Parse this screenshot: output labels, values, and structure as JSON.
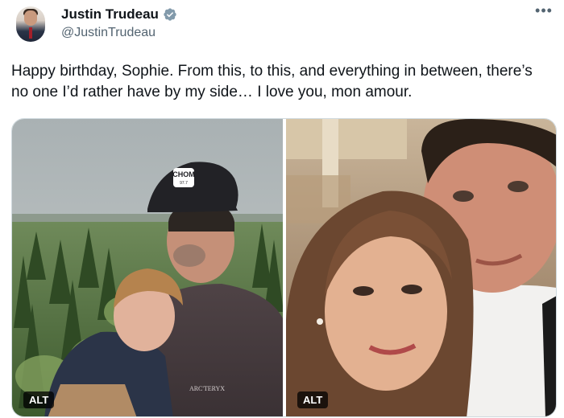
{
  "author": {
    "name": "Justin Trudeau",
    "handle": "@JustinTrudeau",
    "verified": true
  },
  "post": {
    "text": "Happy birthday, Sophie. From this, to this, and everything in between, there’s no one I’d rather have by my side… I love you, mon amour."
  },
  "media": [
    {
      "alt_label": "ALT",
      "cap_text": "CHOM",
      "cap_subtext": "97.7",
      "jacket_brand": "ARC'TERYX"
    },
    {
      "alt_label": "ALT"
    }
  ],
  "icons": {
    "more": "more-horizontal-icon",
    "verified": "verified-badge-icon"
  },
  "colors": {
    "text": "#0f1419",
    "secondary": "#536471",
    "verified": "#829aab",
    "border": "#cfd9de"
  }
}
